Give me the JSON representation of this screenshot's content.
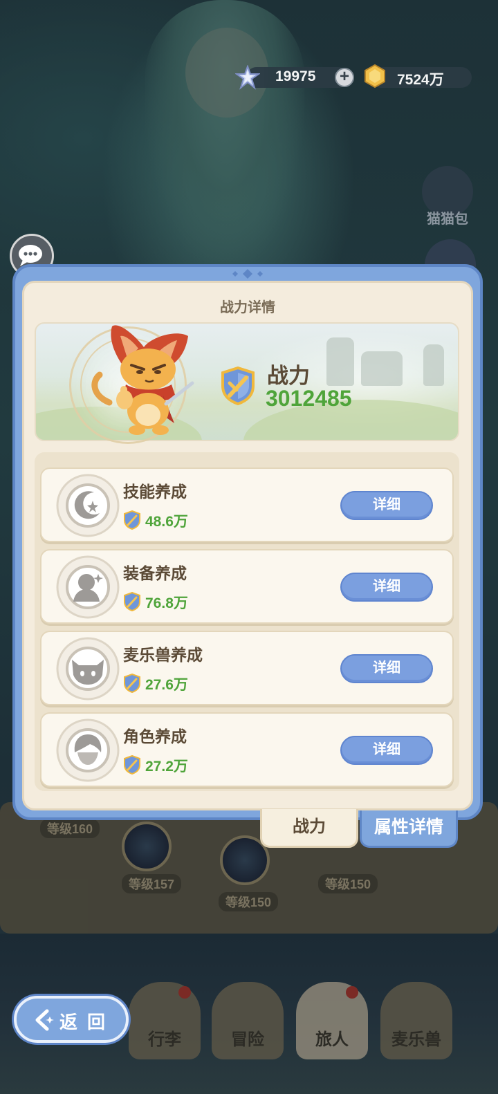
{
  "currency": {
    "stars": "19975",
    "coins": "7524万"
  },
  "side": {
    "bag_label": "猫猫包"
  },
  "modal": {
    "title": "战力详情",
    "power_label": "战力",
    "power_value": "3012485",
    "rows": [
      {
        "title": "技能养成",
        "value": "48.6万",
        "button": "详细",
        "icon": "moon-star-icon"
      },
      {
        "title": "装备养成",
        "value": "76.8万",
        "button": "详细",
        "icon": "character-silhouette-icon"
      },
      {
        "title": "麦乐兽养成",
        "value": "27.6万",
        "button": "详细",
        "icon": "cat-face-icon"
      },
      {
        "title": "角色养成",
        "value": "27.2万",
        "button": "详细",
        "icon": "hero-head-icon"
      }
    ]
  },
  "tabs": {
    "active": "战力",
    "inactive": "属性详情"
  },
  "background": {
    "levels": [
      "等级160",
      "等级157",
      "等级150",
      "等级150"
    ]
  },
  "bottom_nav": [
    "行李",
    "冒险",
    "旅人",
    "麦乐兽"
  ],
  "back_label": "返回"
}
